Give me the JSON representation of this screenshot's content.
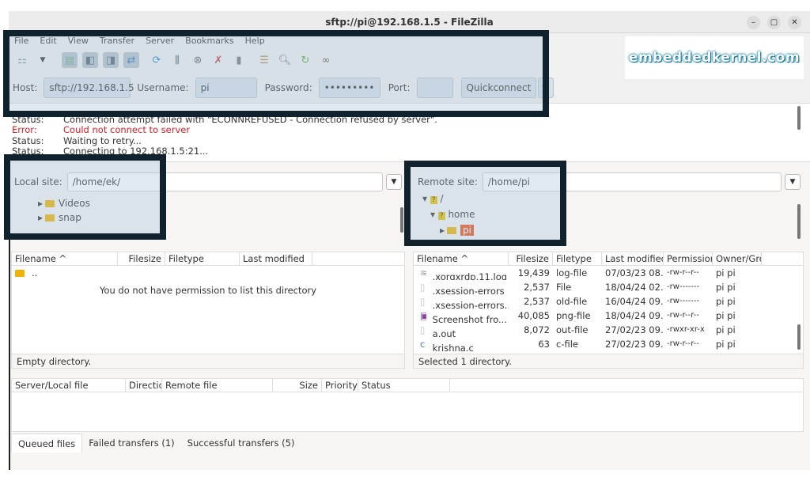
{
  "window": {
    "title": "sftp://pi@192.168.1.5 - FileZilla",
    "controls": [
      "–",
      "▢",
      "✕"
    ]
  },
  "menu": [
    "File",
    "Edit",
    "View",
    "Transfer",
    "Server",
    "Bookmarks",
    "Help"
  ],
  "toolbar_icons": [
    "site-manager",
    "dropdown",
    "toggle-log",
    "toggle-local-tree",
    "toggle-remote-tree",
    "toggle-queue",
    "refresh",
    "process-queue",
    "cancel",
    "disconnect",
    "reconnect",
    "filter",
    "compare",
    "sync-browse",
    "search"
  ],
  "quickconnect": {
    "host_label": "Host:",
    "host": "sftp://192.168.1.5",
    "user_label": "Username:",
    "user": "pi",
    "pass_label": "Password:",
    "pass": "•••••••••",
    "port_label": "Port:",
    "port": "",
    "button": "Quickconnect",
    "arrow": "▾"
  },
  "logo": "embeddedkernel.com",
  "log": [
    {
      "k": "Status:",
      "v": "Connection attempt failed with \"ECONNREFUSED - Connection refused by server\".",
      "err": false
    },
    {
      "k": "Error:",
      "v": "Could not connect to server",
      "err": true
    },
    {
      "k": "Status:",
      "v": "Waiting to retry...",
      "err": false
    },
    {
      "k": "Status:",
      "v": "Connecting to 192.168.1.5:21...",
      "err": false
    }
  ],
  "local": {
    "label": "Local site:",
    "path": "/home/ek/",
    "tree": [
      "Videos",
      "snap"
    ],
    "headers": [
      "Filename ^",
      "Filesize",
      "Filetype",
      "Last modified"
    ],
    "rows": [
      ".."
    ],
    "message": "You do not have permission to list this directory",
    "status": "Empty directory."
  },
  "remote": {
    "label": "Remote site:",
    "path": "/home/pi",
    "tree": [
      "/",
      "home",
      "pi"
    ],
    "headers": [
      "Filename ^",
      "Filesize",
      "Filetype",
      "Last modified",
      "Permission",
      "Owner/Grou"
    ],
    "rows": [
      {
        "name": ".xorgxrdp.11.log",
        "size": "19,439",
        "type": "log-file",
        "mod": "07/03/23 08...",
        "perm": "-rw-r--r--",
        "owner": "pi pi",
        "icon": "log-file-icon"
      },
      {
        "name": ".xsession-errors",
        "size": "2,537",
        "type": "File",
        "mod": "18/04/24 02...",
        "perm": "-rw-------",
        "owner": "pi pi",
        "icon": "file-icon"
      },
      {
        "name": ".xsession-errors...",
        "size": "2,537",
        "type": "old-file",
        "mod": "16/04/24 09...",
        "perm": "-rw-------",
        "owner": "pi pi",
        "icon": "file-icon"
      },
      {
        "name": "Screenshot fro...",
        "size": "40,085",
        "type": "png-file",
        "mod": "18/04/24 09...",
        "perm": "-rw-r--r--",
        "owner": "pi pi",
        "icon": "image-icon"
      },
      {
        "name": "a.out",
        "size": "8,072",
        "type": "out-file",
        "mod": "27/02/23 09...",
        "perm": "-rwxr-xr-x",
        "owner": "pi pi",
        "icon": "file-icon"
      },
      {
        "name": "krishna.c",
        "size": "63",
        "type": "c-file",
        "mod": "27/02/23 09...",
        "perm": "-rw-r--r--",
        "owner": "pi pi",
        "icon": "c-file-icon"
      }
    ],
    "status": "Selected 1 directory."
  },
  "queue": {
    "headers": [
      "Server/Local file",
      "Directio",
      "Remote file",
      "Size",
      "Priority",
      "Status"
    ],
    "tabs": [
      "Queued files",
      "Failed transfers (1)",
      "Successful transfers (5)"
    ]
  }
}
